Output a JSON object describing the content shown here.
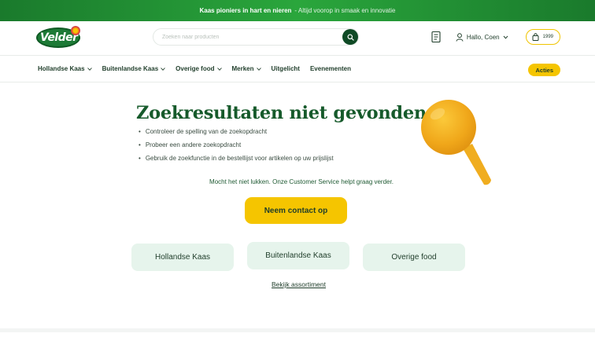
{
  "topbar": {
    "strong": "Kaas pioniers in hart en nieren",
    "rest": "- Altijd voorop in smaak en innovatie"
  },
  "logo": {
    "text": "Velder"
  },
  "search": {
    "placeholder": "Zoeken naar producten",
    "value": ""
  },
  "header": {
    "user_greeting": "Hallo, Coen",
    "cart_total": "1999"
  },
  "nav": {
    "items": [
      {
        "label": "Hollandse Kaas",
        "dropdown": true
      },
      {
        "label": "Buitenlandse Kaas",
        "dropdown": true
      },
      {
        "label": "Overige food",
        "dropdown": true
      },
      {
        "label": "Merken",
        "dropdown": true
      },
      {
        "label": "Uitgelicht",
        "dropdown": false
      },
      {
        "label": "Evenementen",
        "dropdown": false
      }
    ],
    "acties": "Acties"
  },
  "main": {
    "title": "Zoekresultaten niet gevonden",
    "tips": [
      "Controleer de spelling van de zoekopdracht",
      "Probeer een andere zoekopdracht",
      "Gebruik de zoekfunctie in de bestellijst voor artikelen op uw prijslijst"
    ],
    "cs_text": "Mocht het niet lukken. Onze Customer Service helpt graag verder.",
    "contact_button": "Neem contact op",
    "categories": [
      "Hollandse Kaas",
      "Buitenlandse Kaas",
      "Overige food"
    ],
    "assortment_link": "Bekijk assortiment"
  },
  "colors": {
    "brand_green": "#165a2b",
    "accent_yellow": "#f5c500",
    "category_bg": "#e6f4ec"
  },
  "icons": [
    "search-icon",
    "shopping-list-icon",
    "user-icon",
    "chevron-down-icon",
    "shopping-bag-icon",
    "magnifier-illustration"
  ]
}
